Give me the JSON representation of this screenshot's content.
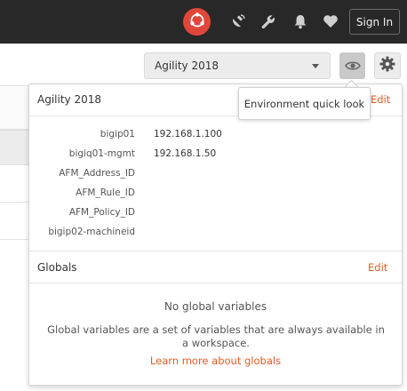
{
  "header": {
    "sign_in_label": "Sign In",
    "icons": [
      "sync-icon",
      "satellite-icon",
      "wrench-icon",
      "bell-icon",
      "heart-icon"
    ],
    "colors": {
      "bar": "#282828",
      "sync": "#e0473a"
    }
  },
  "environment": {
    "selected": "Agility 2018",
    "icons": [
      "eye-icon",
      "gear-icon"
    ]
  },
  "tooltip": {
    "text": "Environment quick look"
  },
  "panel": {
    "env_title": "Agility 2018",
    "edit_label": "Edit",
    "variables": [
      {
        "key": "bigip01",
        "value": "192.168.1.100"
      },
      {
        "key": "bigiq01-mgmt",
        "value": "192.168.1.50"
      },
      {
        "key": "AFM_Address_ID",
        "value": ""
      },
      {
        "key": "AFM_Rule_ID",
        "value": ""
      },
      {
        "key": "AFM_Policy_ID",
        "value": ""
      },
      {
        "key": "bigip02-machineid",
        "value": ""
      }
    ],
    "globals_title": "Globals",
    "globals_edit_label": "Edit",
    "empty_title": "No global variables",
    "empty_desc": "Global variables are a set of variables that are always available in a workspace.",
    "learn_more": "Learn more about globals",
    "accent_color": "#e25b25"
  }
}
